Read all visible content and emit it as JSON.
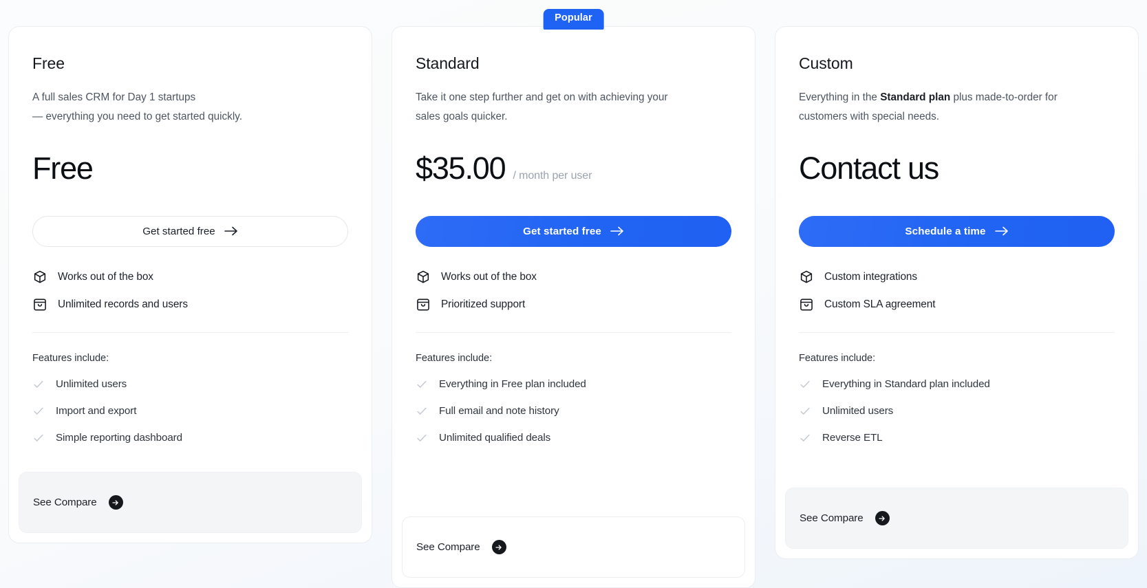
{
  "page": {
    "background_accent": "#eef4fb",
    "brand_blue": "#1f63f5"
  },
  "plans": [
    {
      "id": "free",
      "name": "Free",
      "description_line1": "A full sales CRM for Day 1 startups",
      "description_line2": "— everything you need to get started quickly.",
      "price": "Free",
      "price_suffix": "",
      "cta_label": "Get started free",
      "cta_style": "outline",
      "badge": "",
      "highlights": [
        {
          "icon": "cube-icon",
          "label": "Works out of the box"
        },
        {
          "icon": "archive-box-icon",
          "label": "Unlimited records and users"
        }
      ],
      "features_title": "Features include:",
      "features": [
        "Unlimited users",
        "Import and export",
        "Simple reporting dashboard"
      ],
      "compare_label": "See Compare"
    },
    {
      "id": "standard",
      "name": "Standard",
      "description_line1": "Take it one step further and get on with achieving your",
      "description_line2": "sales goals quicker.",
      "price": "$35.00",
      "price_suffix": "/ month per user",
      "cta_label": "Get started free",
      "cta_style": "primary",
      "badge": "Popular",
      "highlights": [
        {
          "icon": "cube-icon",
          "label": "Works out of the box"
        },
        {
          "icon": "archive-box-icon",
          "label": "Prioritized support"
        }
      ],
      "features_title": "Features include:",
      "features": [
        "Everything in Free plan included",
        "Full email and note history",
        "Unlimited qualified deals"
      ],
      "compare_label": "See Compare"
    },
    {
      "id": "custom",
      "name": "Custom",
      "description_prefix": "Everything in the ",
      "description_bold": "Standard plan",
      "description_suffix": " plus made-to-order for customers with special needs.",
      "price": "Contact us",
      "price_suffix": "",
      "cta_label": "Schedule a time",
      "cta_style": "primary",
      "badge": "",
      "highlights": [
        {
          "icon": "cube-icon",
          "label": "Custom integrations"
        },
        {
          "icon": "archive-box-icon",
          "label": "Custom SLA agreement"
        }
      ],
      "features_title": "Features include:",
      "features": [
        "Everything in Standard plan included",
        "Unlimited users",
        "Reverse ETL"
      ],
      "compare_label": "See Compare"
    }
  ]
}
